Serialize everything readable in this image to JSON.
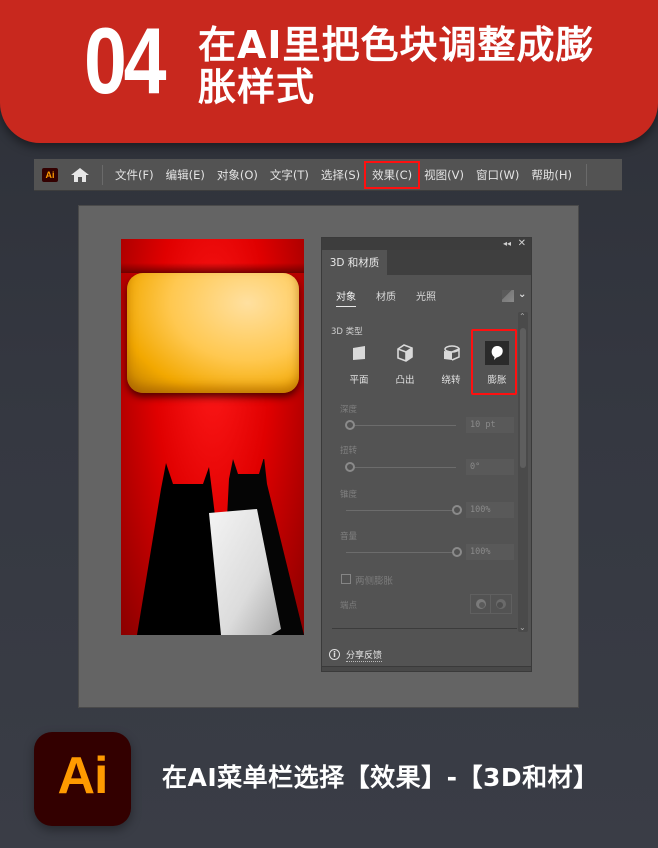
{
  "banner": {
    "step_number": "04",
    "title": "在AI里把色块调整成膨胀样式",
    "background_color": "#c8281e"
  },
  "menubar": {
    "app_icon_label": "Ai",
    "home_icon": "home-icon",
    "items": [
      {
        "label": "文件(F)",
        "highlighted": false
      },
      {
        "label": "编辑(E)",
        "highlighted": false
      },
      {
        "label": "对象(O)",
        "highlighted": false
      },
      {
        "label": "文字(T)",
        "highlighted": false
      },
      {
        "label": "选择(S)",
        "highlighted": false
      },
      {
        "label": "效果(C)",
        "highlighted": true
      },
      {
        "label": "视图(V)",
        "highlighted": false
      },
      {
        "label": "窗口(W)",
        "highlighted": false
      },
      {
        "label": "帮助(H)",
        "highlighted": false
      }
    ],
    "highlight_color": "#ff1010"
  },
  "panel": {
    "collapse_glyph": "◂◂",
    "close_glyph": "✕",
    "tab_title": "3D 和材质",
    "subtabs": [
      {
        "label": "对象",
        "active": true
      },
      {
        "label": "材质",
        "active": false
      },
      {
        "label": "光照",
        "active": false
      }
    ],
    "type_section_label": "3D 类型",
    "types": [
      {
        "label": "平面",
        "icon": "plane-icon",
        "selected": false
      },
      {
        "label": "凸出",
        "icon": "extrude-icon",
        "selected": false
      },
      {
        "label": "绕转",
        "icon": "revolve-icon",
        "selected": false
      },
      {
        "label": "膨胀",
        "icon": "inflate-icon",
        "selected": true
      }
    ],
    "properties": [
      {
        "label": "深度",
        "value": "10 pt",
        "slider_fraction": 0
      },
      {
        "label": "扭转",
        "value": "0°",
        "slider_fraction": 0
      },
      {
        "label": "锥度",
        "value": "100%",
        "slider_fraction": 1
      },
      {
        "label": "音量",
        "value": "100%",
        "slider_fraction": 1
      }
    ],
    "checkbox": {
      "label": "两侧膨胀",
      "checked": false
    },
    "cap_label": "端点",
    "feedback_label": "分享反馈"
  },
  "caption": {
    "text": "在AI菜单栏选择【效果】-【3D和材】",
    "logo_text": "Ai",
    "logo_bg": "#330000",
    "logo_fg": "#ff9a00"
  }
}
